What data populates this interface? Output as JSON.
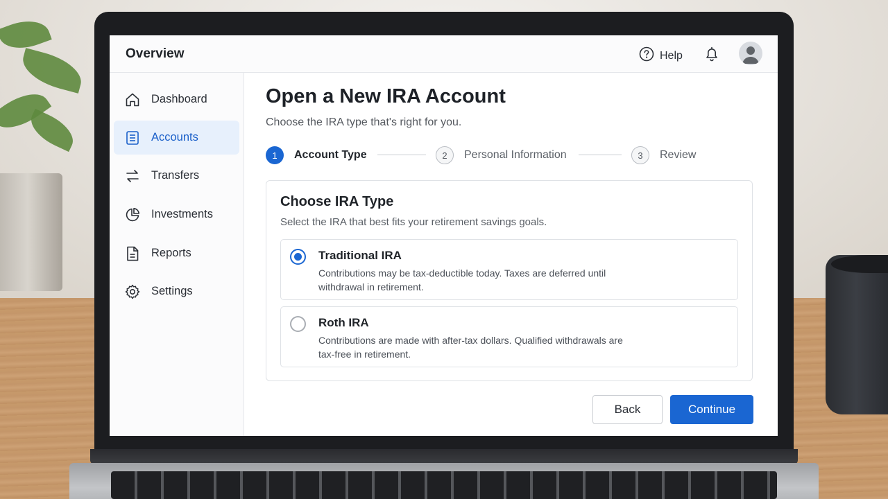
{
  "app": {
    "title": "Overview"
  },
  "header": {
    "help_label": "Help",
    "icons": [
      "help-circle-icon",
      "bell-icon",
      "user-avatar-icon"
    ]
  },
  "sidebar": {
    "items": [
      {
        "label": "Dashboard",
        "icon": "home-icon",
        "active": false
      },
      {
        "label": "Accounts",
        "icon": "document-list-icon",
        "active": true
      },
      {
        "label": "Transfers",
        "icon": "arrows-swap-icon",
        "active": false
      },
      {
        "label": "Investments",
        "icon": "chart-circle-icon",
        "active": false
      },
      {
        "label": "Reports",
        "icon": "report-file-icon",
        "active": false
      },
      {
        "label": "Settings",
        "icon": "gear-icon",
        "active": false
      }
    ]
  },
  "page": {
    "title": "Open a New IRA Account",
    "subtitle": "Choose the IRA type that's right for you."
  },
  "stepper": {
    "steps": [
      {
        "number": "1",
        "label": "Account Type",
        "state": "current"
      },
      {
        "number": "2",
        "label": "Personal Information",
        "state": "upcoming"
      },
      {
        "number": "3",
        "label": "Review",
        "state": "upcoming"
      }
    ]
  },
  "ira_card": {
    "title": "Choose IRA Type",
    "subtitle": "Select the IRA that best fits your retirement savings goals.",
    "options": [
      {
        "title": "Traditional IRA",
        "description": "Contributions may be tax-deductible today. Taxes are deferred until withdrawal in retirement.",
        "selected": true
      },
      {
        "title": "Roth IRA",
        "description": "Contributions are made with after-tax dollars. Qualified withdrawals are tax-free in retirement.",
        "selected": false
      }
    ]
  },
  "actions": {
    "back_label": "Back",
    "continue_label": "Continue"
  },
  "colors": {
    "accent": "#1a66d2",
    "active_nav_bg": "#e7f0fc",
    "border": "#dfe2e6"
  }
}
